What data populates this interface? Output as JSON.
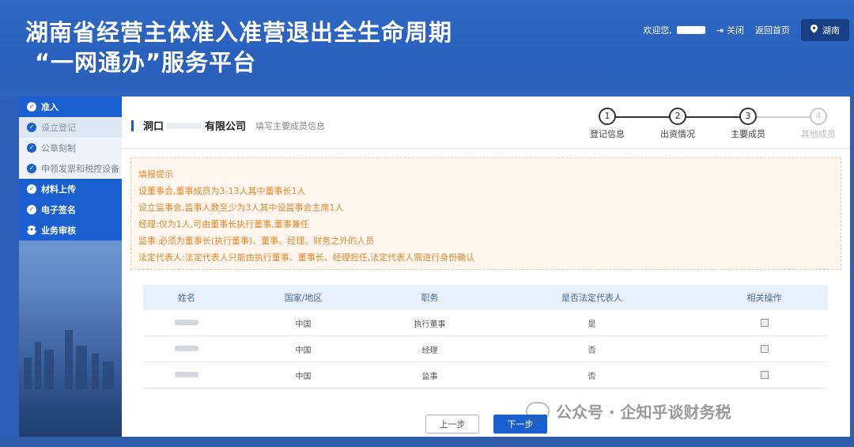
{
  "header": {
    "title_line1": "湖南省经营主体准入准营退出全生命周期",
    "title_line2": "“一网通办”服务平台",
    "welcome": "欢迎您,",
    "close_label": "关闭",
    "home_label": "返回首页",
    "region_label": "湖南"
  },
  "sidebar": {
    "items": [
      {
        "label": "准入",
        "type": "main"
      },
      {
        "label": "设立登记",
        "type": "sub"
      },
      {
        "label": "公章刻制",
        "type": "sub"
      },
      {
        "label": "申领发票和税控设备",
        "type": "sub"
      },
      {
        "label": "材料上传",
        "type": "main"
      },
      {
        "label": "电子签名",
        "type": "main"
      },
      {
        "label": "业务审核",
        "type": "main"
      }
    ]
  },
  "form": {
    "company_prefix": "洞口",
    "company_suffix": "有限公司",
    "hint": "填写主要成员信息"
  },
  "steps": [
    {
      "num": "1",
      "label": "登记信息",
      "state": "done"
    },
    {
      "num": "2",
      "label": "出资情况",
      "state": "done"
    },
    {
      "num": "3",
      "label": "主要成员",
      "state": "current"
    },
    {
      "num": "4",
      "label": "其他成员",
      "state": "todo"
    }
  ],
  "notice": {
    "lines": [
      "填报提示",
      "设董事会,董事成员为3-13人其中董事长1人",
      "设立监事会,监事人数至少为3人其中设监事会主席1人",
      "经理:仅为1人,可由董事长执行董事,董事兼任",
      "监事:必须为董事长(执行董事)、董事、经理、财务之外的人员",
      "法定代表人:法定代表人只能由执行董事、董事长、经理担任,法定代表人需进行身份确认"
    ]
  },
  "table": {
    "headers": [
      "姓名",
      "国家/地区",
      "职务",
      "是否法定代表人",
      "相关操作"
    ],
    "rows": [
      {
        "country": "中国",
        "position": "执行董事",
        "legal_rep": "是"
      },
      {
        "country": "中国",
        "position": "经理",
        "legal_rep": "否"
      },
      {
        "country": "中国",
        "position": "监事",
        "legal_rep": "否"
      }
    ]
  },
  "buttons": {
    "prev": "上一步",
    "next": "下一步"
  },
  "watermark": "公众号 · 企知乎谈财务税"
}
